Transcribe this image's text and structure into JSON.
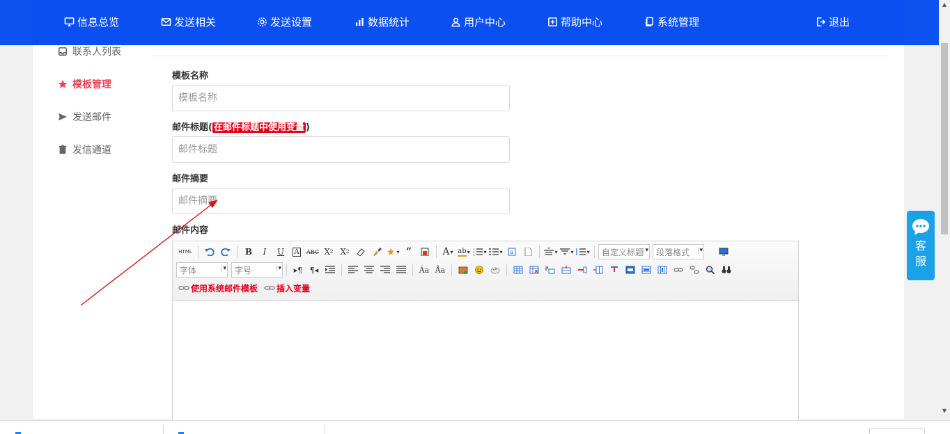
{
  "nav": {
    "items": [
      {
        "label": "信息总览",
        "icon": "monitor-icon"
      },
      {
        "label": "发送相关",
        "icon": "mail-icon"
      },
      {
        "label": "发送设置",
        "icon": "gear-icon"
      },
      {
        "label": "数据统计",
        "icon": "bar-chart-icon"
      },
      {
        "label": "用户中心",
        "icon": "user-icon"
      },
      {
        "label": "帮助中心",
        "icon": "help-icon"
      },
      {
        "label": "系统管理",
        "icon": "copy-icon"
      }
    ],
    "logout": "退出"
  },
  "sidebar": {
    "items": [
      {
        "label": "联系人列表",
        "icon": "inbox-icon"
      },
      {
        "label": "模板管理",
        "icon": "star-icon",
        "active": true
      },
      {
        "label": "发送邮件",
        "icon": "send-icon"
      },
      {
        "label": "发信通道",
        "icon": "trash-icon"
      }
    ]
  },
  "form": {
    "template_name_label": "模板名称",
    "template_name_placeholder": "模板名称",
    "subject_label": "邮件标题",
    "subject_paren_open": "(",
    "subject_hint": "在邮件标题中使用变量",
    "subject_paren_close": ")",
    "subject_placeholder": "邮件标题",
    "summary_label": "邮件摘要",
    "summary_placeholder": "邮件摘要",
    "content_label": "邮件内容"
  },
  "editor": {
    "html_label": "HTML",
    "custom_title": "自定义标题",
    "paragraph_format": "段落格式",
    "font_family": "字体",
    "font_size": "字号",
    "use_template_link": "使用系统邮件模板",
    "insert_variable_link": "插入变量"
  },
  "service": {
    "line1": "客",
    "line2": "服"
  },
  "colors": {
    "nav_bg": "#0b4ff0",
    "accent_red": "#e7465b",
    "highlight_red": "#e4001b",
    "service_blue": "#1ba1e6"
  }
}
